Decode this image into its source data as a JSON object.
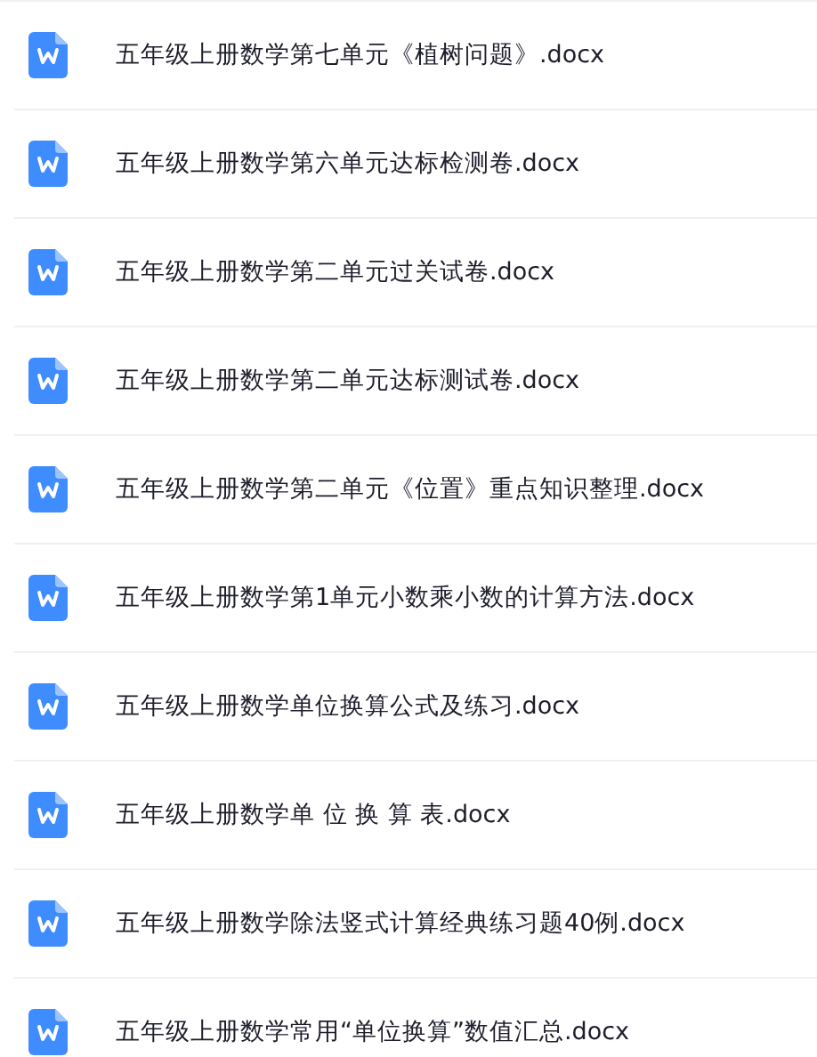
{
  "files": [
    {
      "name": "五年级上册数学第七单元《植树问题》.docx"
    },
    {
      "name": "五年级上册数学第六单元达标检测卷.docx"
    },
    {
      "name": "五年级上册数学第二单元过关试卷.docx"
    },
    {
      "name": "五年级上册数学第二单元达标测试卷.docx"
    },
    {
      "name": "五年级上册数学第二单元《位置》重点知识整理.docx"
    },
    {
      "name": "五年级上册数学第1单元小数乘小数的计算方法.docx"
    },
    {
      "name": "五年级上册数学单位换算公式及练习.docx"
    },
    {
      "name": "五年级上册数学单 位 换 算 表.docx"
    },
    {
      "name": "五年级上册数学除法竖式计算经典练习题40例.docx"
    },
    {
      "name": "五年级上册数学常用“单位换算”数值汇总.docx"
    }
  ]
}
